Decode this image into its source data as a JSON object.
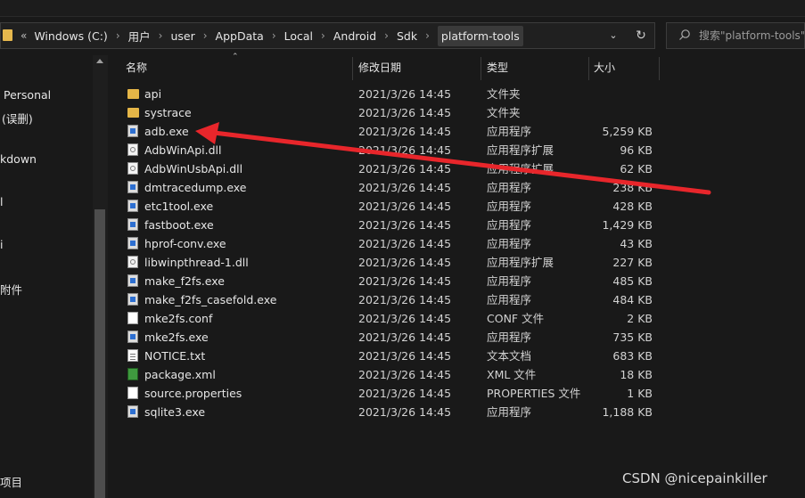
{
  "address_bar": {
    "lead": "«",
    "crumbs": [
      "Windows (C:)",
      "用户",
      "user",
      "AppData",
      "Local",
      "Android",
      "Sdk",
      "platform-tools"
    ]
  },
  "search": {
    "placeholder": "搜索\"platform-tools\""
  },
  "sidebar": {
    "items": [
      "Personal",
      "(误删)",
      "kdown",
      "l",
      "i",
      "附件",
      "项目"
    ]
  },
  "columns": {
    "name": "名称",
    "date": "修改日期",
    "type": "类型",
    "size": "大小"
  },
  "files": [
    {
      "name": "api",
      "date": "2021/3/26 14:45",
      "type": "文件夹",
      "size": "",
      "icon": "folder-icon"
    },
    {
      "name": "systrace",
      "date": "2021/3/26 14:45",
      "type": "文件夹",
      "size": "",
      "icon": "folder-icon"
    },
    {
      "name": "adb.exe",
      "date": "2021/3/26 14:45",
      "type": "应用程序",
      "size": "5,259 KB",
      "icon": "exe-icon"
    },
    {
      "name": "AdbWinApi.dll",
      "date": "2021/3/26 14:45",
      "type": "应用程序扩展",
      "size": "96 KB",
      "icon": "dll-icon"
    },
    {
      "name": "AdbWinUsbApi.dll",
      "date": "2021/3/26 14:45",
      "type": "应用程序扩展",
      "size": "62 KB",
      "icon": "dll-icon"
    },
    {
      "name": "dmtracedump.exe",
      "date": "2021/3/26 14:45",
      "type": "应用程序",
      "size": "238 KB",
      "icon": "exe-icon"
    },
    {
      "name": "etc1tool.exe",
      "date": "2021/3/26 14:45",
      "type": "应用程序",
      "size": "428 KB",
      "icon": "exe-icon"
    },
    {
      "name": "fastboot.exe",
      "date": "2021/3/26 14:45",
      "type": "应用程序",
      "size": "1,429 KB",
      "icon": "exe-icon"
    },
    {
      "name": "hprof-conv.exe",
      "date": "2021/3/26 14:45",
      "type": "应用程序",
      "size": "43 KB",
      "icon": "exe-icon"
    },
    {
      "name": "libwinpthread-1.dll",
      "date": "2021/3/26 14:45",
      "type": "应用程序扩展",
      "size": "227 KB",
      "icon": "dll-icon"
    },
    {
      "name": "make_f2fs.exe",
      "date": "2021/3/26 14:45",
      "type": "应用程序",
      "size": "485 KB",
      "icon": "exe-icon"
    },
    {
      "name": "make_f2fs_casefold.exe",
      "date": "2021/3/26 14:45",
      "type": "应用程序",
      "size": "484 KB",
      "icon": "exe-icon"
    },
    {
      "name": "mke2fs.conf",
      "date": "2021/3/26 14:45",
      "type": "CONF 文件",
      "size": "2 KB",
      "icon": "document-icon"
    },
    {
      "name": "mke2fs.exe",
      "date": "2021/3/26 14:45",
      "type": "应用程序",
      "size": "735 KB",
      "icon": "exe-icon"
    },
    {
      "name": "NOTICE.txt",
      "date": "2021/3/26 14:45",
      "type": "文本文档",
      "size": "683 KB",
      "icon": "text-file-icon"
    },
    {
      "name": "package.xml",
      "date": "2021/3/26 14:45",
      "type": "XML 文件",
      "size": "18 KB",
      "icon": "xml-file-icon"
    },
    {
      "name": "source.properties",
      "date": "2021/3/26 14:45",
      "type": "PROPERTIES 文件",
      "size": "1 KB",
      "icon": "document-icon"
    },
    {
      "name": "sqlite3.exe",
      "date": "2021/3/26 14:45",
      "type": "应用程序",
      "size": "1,188 KB",
      "icon": "exe-icon"
    }
  ],
  "annotation": {
    "arrow_color": "#e8262b"
  },
  "watermark": "CSDN @nicepainkiller"
}
